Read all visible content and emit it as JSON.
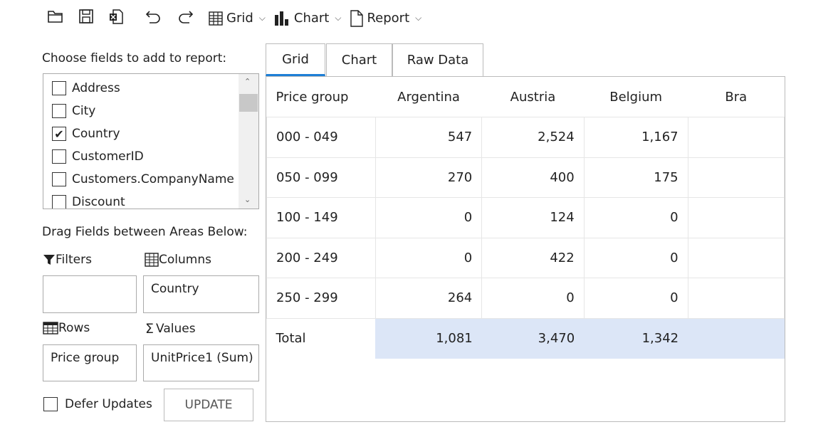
{
  "toolbar": {
    "grid": "Grid",
    "chart": "Chart",
    "report": "Report"
  },
  "fields": {
    "label": "Choose fields to add to report:",
    "items": [
      {
        "label": "Address",
        "checked": false
      },
      {
        "label": "City",
        "checked": false
      },
      {
        "label": "Country",
        "checked": true
      },
      {
        "label": "CustomerID",
        "checked": false
      },
      {
        "label": "Customers.CompanyName",
        "checked": false
      },
      {
        "label": "Discount",
        "checked": false
      }
    ]
  },
  "areas": {
    "label": "Drag Fields between Areas Below:",
    "filters": "Filters",
    "columns": "Columns",
    "rows": "Rows",
    "values": "Values",
    "columns_value": "Country",
    "rows_value": "Price group",
    "values_value": "UnitPrice1 (Sum)"
  },
  "defer": {
    "label": "Defer Updates",
    "checked": false
  },
  "update": "UPDATE",
  "tabs": [
    "Grid",
    "Chart",
    "Raw Data"
  ],
  "accent": "#1e7fd6",
  "grid": {
    "headers": [
      "Price group",
      "Argentina",
      "Austria",
      "Belgium",
      "Bra"
    ],
    "rows": [
      [
        "000 - 049",
        "547",
        "2,524",
        "1,167"
      ],
      [
        "050 - 099",
        "270",
        "400",
        "175"
      ],
      [
        "100 - 149",
        "0",
        "124",
        "0"
      ],
      [
        "200 - 249",
        "0",
        "422",
        "0"
      ],
      [
        "250 - 299",
        "264",
        "0",
        "0"
      ]
    ],
    "total": [
      "Total",
      "1,081",
      "3,470",
      "1,342"
    ]
  }
}
